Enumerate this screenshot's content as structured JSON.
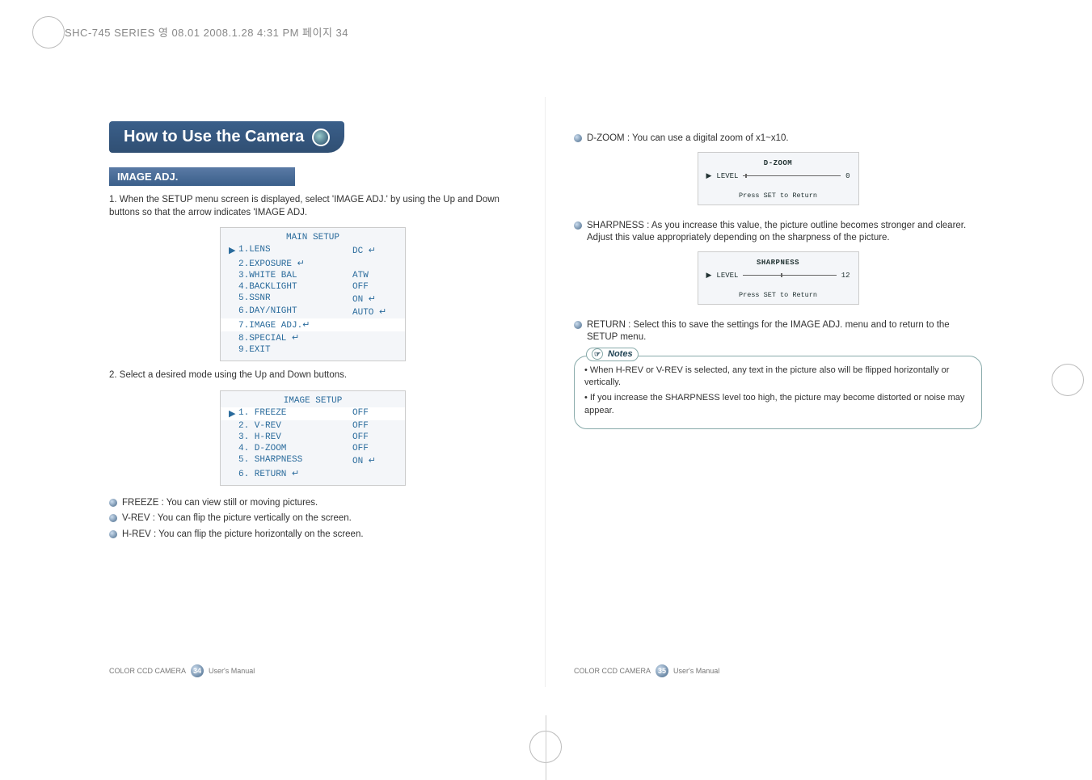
{
  "header_label": "SHC-745 SERIES 영 08.01  2008.1.28 4:31 PM  페이지 34",
  "title": "How to Use the Camera",
  "left_page": {
    "section": "IMAGE ADJ.",
    "step1": "1. When the SETUP menu screen is displayed, select  'IMAGE ADJ.' by using the Up and Down buttons so that the arrow indicates  'IMAGE ADJ.",
    "main_menu": {
      "title": "MAIN SETUP",
      "rows": [
        {
          "arrow": "▶",
          "label": "1.LENS",
          "val": "DC ↵",
          "hl": false
        },
        {
          "arrow": "",
          "label": "2.EXPOSURE ↵",
          "val": "",
          "hl": false
        },
        {
          "arrow": "",
          "label": "3.WHITE BAL",
          "val": "ATW",
          "hl": false
        },
        {
          "arrow": "",
          "label": "4.BACKLIGHT",
          "val": "OFF",
          "hl": false
        },
        {
          "arrow": "",
          "label": "5.SSNR",
          "val": "ON ↵",
          "hl": false
        },
        {
          "arrow": "",
          "label": "6.DAY/NIGHT",
          "val": "AUTO ↵",
          "hl": false
        },
        {
          "arrow": "",
          "label": "7.IMAGE ADJ.↵",
          "val": "",
          "hl": true
        },
        {
          "arrow": "",
          "label": "8.SPECIAL ↵",
          "val": "",
          "hl": false
        },
        {
          "arrow": "",
          "label": "9.EXIT",
          "val": "",
          "hl": false
        }
      ]
    },
    "step2": "2. Select a desired mode using the Up and Down buttons.",
    "image_menu": {
      "title": "IMAGE SETUP",
      "rows": [
        {
          "arrow": "▶",
          "label": "1. FREEZE",
          "val": "OFF",
          "hl": true
        },
        {
          "arrow": "",
          "label": "2. V-REV",
          "val": "OFF",
          "hl": false
        },
        {
          "arrow": "",
          "label": "3. H-REV",
          "val": "OFF",
          "hl": false
        },
        {
          "arrow": "",
          "label": "4. D-ZOOM",
          "val": "OFF",
          "hl": false
        },
        {
          "arrow": "",
          "label": "5. SHARPNESS",
          "val": "ON ↵",
          "hl": false
        },
        {
          "arrow": "",
          "label": "6. RETURN ↵",
          "val": "",
          "hl": false
        }
      ]
    },
    "bullets": [
      "FREEZE : You can view still or moving pictures.",
      "V-REV : You can flip the picture vertically on the screen.",
      "H-REV : You can flip the picture horizontally on the screen."
    ],
    "footer_product": "COLOR CCD CAMERA",
    "footer_page": "34",
    "footer_doc": "User's Manual"
  },
  "right_page": {
    "dzoom_text": "D-ZOOM : You can use a digital zoom of x1~x10.",
    "dzoom_osd": {
      "title": "D-ZOOM",
      "level": "LEVEL",
      "value": "0",
      "foot": "Press SET to Return"
    },
    "sharp_text": "SHARPNESS : As you increase this value, the picture outline becomes stronger and clearer. Adjust this value appropriately depending on the sharpness of the picture.",
    "sharp_osd": {
      "title": "SHARPNESS",
      "level": "LEVEL",
      "value": "12",
      "foot": "Press SET to Return"
    },
    "return_text": "RETURN : Select this to save the settings for the IMAGE ADJ. menu and to return to the SETUP menu.",
    "notes_label": "Notes",
    "notes": [
      "When H-REV or V-REV is selected, any text in the picture also will be flipped horizontally or vertically.",
      "If you increase the  SHARPNESS level too high, the picture may become distorted or noise may appear."
    ],
    "footer_product": "COLOR CCD CAMERA",
    "footer_page": "35",
    "footer_doc": "User's Manual"
  }
}
